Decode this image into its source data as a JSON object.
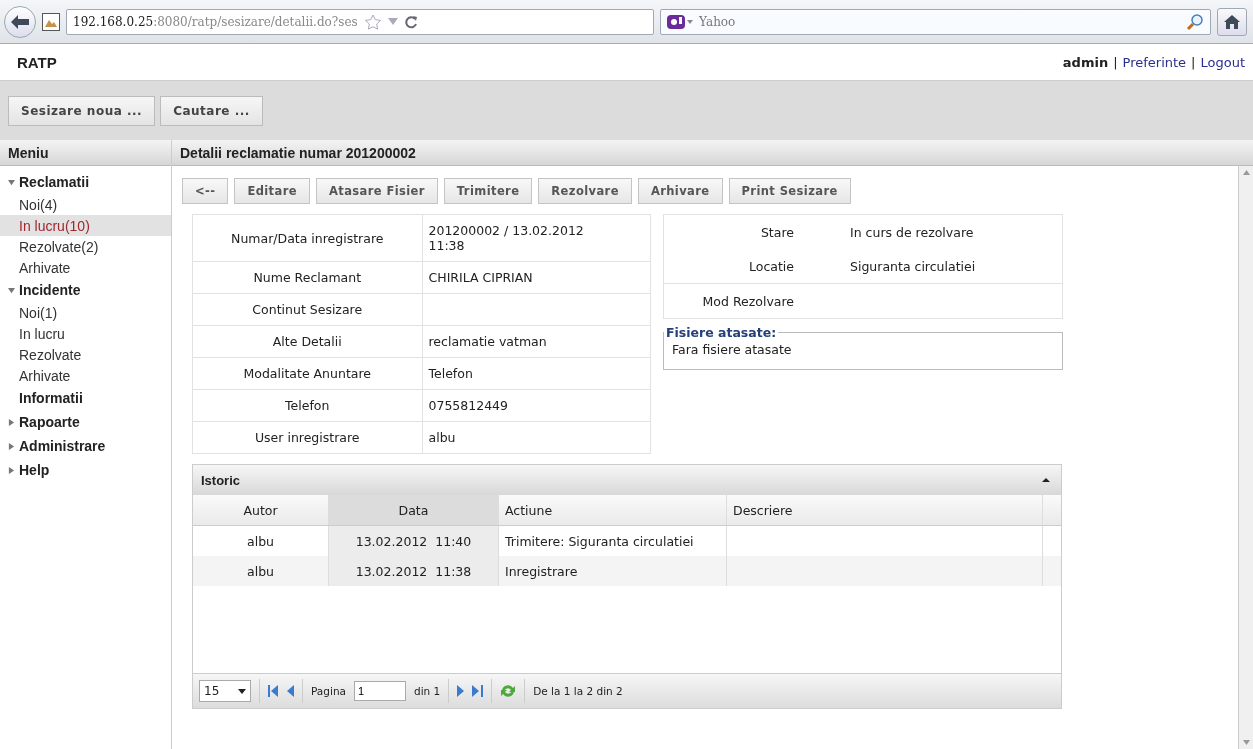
{
  "browser": {
    "url_host": "192.168.0.25",
    "url_rest": ":8080/ratp/sesizare/detalii.do?ses",
    "search_placeholder": "Yahoo"
  },
  "header": {
    "brand": "RATP",
    "user": "admin",
    "separators": [
      "|",
      "|"
    ],
    "links": [
      "Preferinte",
      "Logout"
    ]
  },
  "top_buttons": [
    "Sesizare noua ...",
    "Cautare ..."
  ],
  "sidebar": {
    "title": "Meniu",
    "items": [
      {
        "label": "Reclamatii",
        "kind": "group",
        "expanded": true,
        "children": [
          {
            "label": "Noi(4)",
            "selected": false
          },
          {
            "label": "In lucru(10)",
            "selected": true
          },
          {
            "label": "Rezolvate(2)",
            "selected": false
          },
          {
            "label": "Arhivate",
            "selected": false
          }
        ]
      },
      {
        "label": "Incidente",
        "kind": "group",
        "expanded": true,
        "children": [
          {
            "label": "Noi(1)",
            "selected": false
          },
          {
            "label": "In lucru",
            "selected": false
          },
          {
            "label": "Rezolvate",
            "selected": false
          },
          {
            "label": "Arhivate",
            "selected": false
          }
        ]
      },
      {
        "label": "Informatii",
        "kind": "leaf"
      },
      {
        "label": "Rapoarte",
        "kind": "group",
        "expanded": false
      },
      {
        "label": "Administrare",
        "kind": "group",
        "expanded": false
      },
      {
        "label": "Help",
        "kind": "group",
        "expanded": false
      }
    ]
  },
  "content": {
    "title": "Detalii reclamatie numar 201200002",
    "actions": [
      "<--",
      "Editare",
      "Atasare Fisier",
      "Trimitere",
      "Rezolvare",
      "Arhivare",
      "Print Sesizare"
    ],
    "details": [
      {
        "label": "Numar/Data inregistrare",
        "value": "201200002 / 13.02.2012 11:38"
      },
      {
        "label": "Nume Reclamant",
        "value": "CHIRILA CIPRIAN"
      },
      {
        "label": "Continut Sesizare"
      },
      {
        "label": "Alte Detalii",
        "value": "reclamatie vatman"
      },
      {
        "label": "Modalitate Anuntare",
        "value": "Telefon"
      },
      {
        "label": "Telefon",
        "value": "0755812449"
      },
      {
        "label": "User inregistrare",
        "value": "albu"
      }
    ],
    "status": [
      {
        "label": "Stare",
        "value": "In curs de rezolvare"
      },
      {
        "label": "Locatie",
        "value": "Siguranta circulatiei"
      },
      {
        "label": "Mod Rezolvare"
      }
    ],
    "attachments": {
      "legend": "Fisiere atasate:",
      "text": "Fara fisiere atasate"
    },
    "history": {
      "title": "Istoric",
      "columns": [
        {
          "label": "Autor",
          "sorted": false
        },
        {
          "label": "Data",
          "sorted": true
        },
        {
          "label": "Actiune",
          "sorted": false
        },
        {
          "label": "Descriere",
          "sorted": false
        }
      ],
      "rows": [
        [
          "albu",
          "13.02.2012  11:40",
          "Trimitere: Siguranta circulatiei"
        ],
        [
          "albu",
          "13.02.2012  11:38",
          "Inregistrare"
        ]
      ],
      "pager": {
        "page_size": "15",
        "page_label": "Pagina",
        "page": "1",
        "page_total": "din 1",
        "summary": "De la 1 la 2 din 2"
      }
    }
  }
}
